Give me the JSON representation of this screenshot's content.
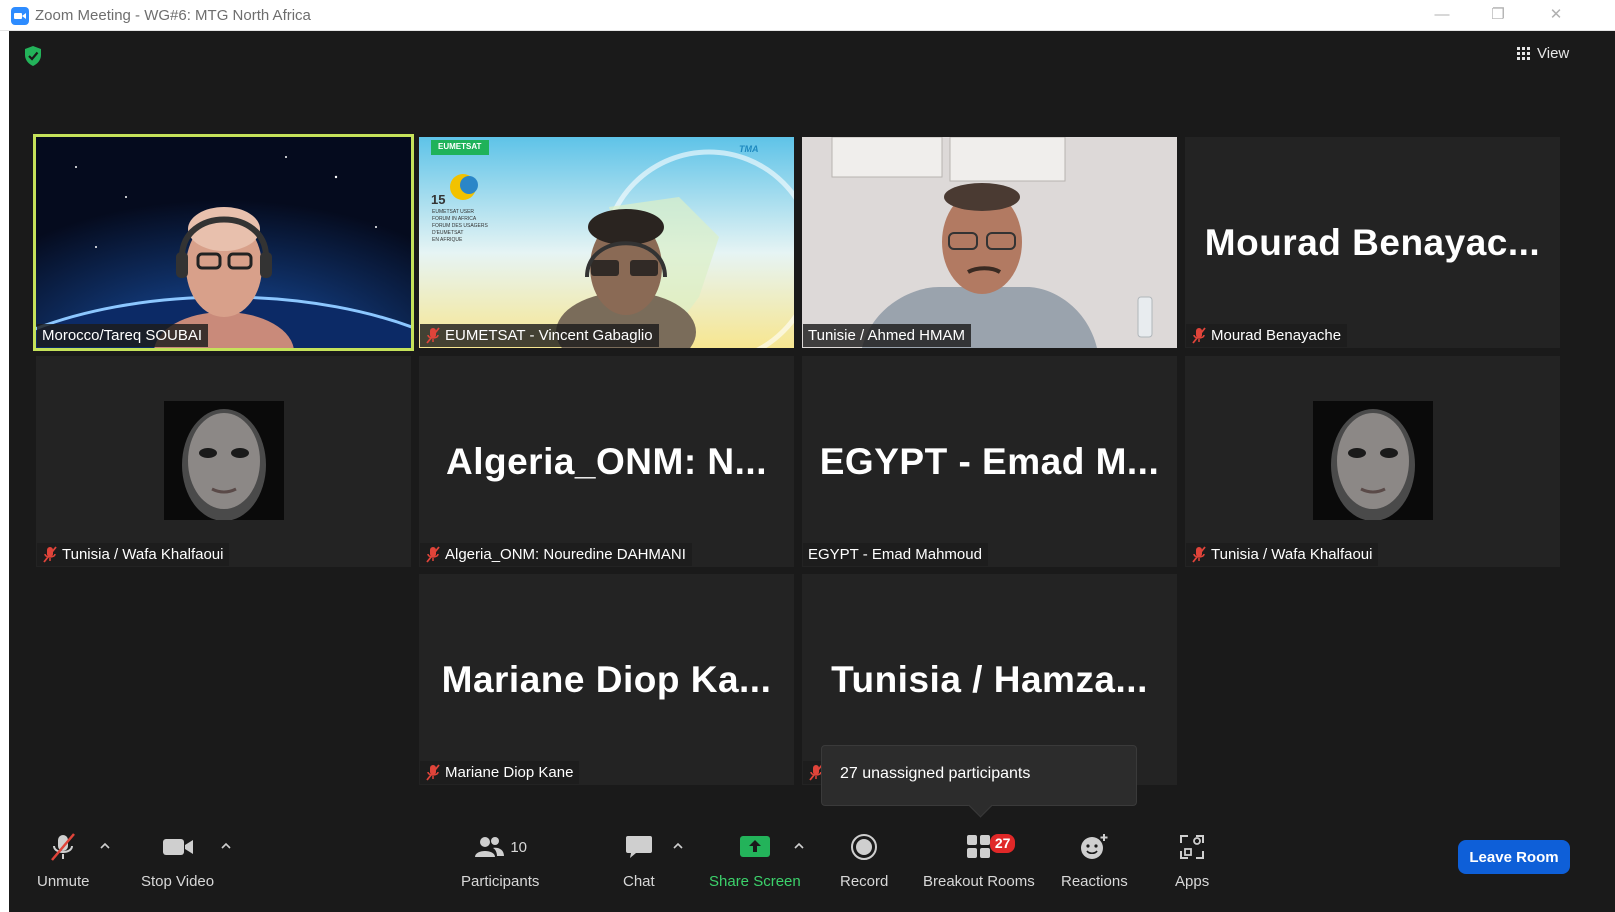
{
  "window": {
    "title": "Zoom Meeting - WG#6: MTG North Africa",
    "minimize_glyph": "—",
    "restore_glyph": "❐",
    "close_glyph": "✕"
  },
  "header": {
    "view_label": "View"
  },
  "tiles": [
    {
      "name": "Morocco/Tareq SOUBAI",
      "big": "",
      "muted": false,
      "active": true
    },
    {
      "name": "EUMETSAT - Vincent Gabaglio",
      "big": "",
      "muted": true,
      "active": false
    },
    {
      "name": "Tunisie / Ahmed HMAM",
      "big": "",
      "muted": false,
      "active": false
    },
    {
      "name": "Mourad Benayache",
      "big": "Mourad  Benayac...",
      "muted": true,
      "active": false
    },
    {
      "name": "Tunisia / Wafa Khalfaoui",
      "big": "",
      "muted": true,
      "active": false
    },
    {
      "name": "Algeria_ONM: Nouredine DAHMANI",
      "big": "Algeria_ONM:  N...",
      "muted": true,
      "active": false
    },
    {
      "name": "EGYPT - Emad Mahmoud",
      "big": "EGYPT  -  Emad  M...",
      "muted": false,
      "active": false
    },
    {
      "name": "Tunisia / Wafa Khalfaoui",
      "big": "",
      "muted": true,
      "active": false
    },
    {
      "name": "Mariane Diop Kane",
      "big": "Mariane  Diop  Ka...",
      "muted": true,
      "active": false
    },
    {
      "name": "",
      "big": "Tunisia  /  Hamza...",
      "muted": true,
      "active": false
    }
  ],
  "slide": {
    "brand": "EUMETSAT",
    "partner": "TMA",
    "number": "15",
    "lines": [
      "EUMETSAT USER",
      "FORUM IN AFRICA",
      "FORUM DES USAGERS",
      "D'EUMETSAT",
      "EN AFRIQUE"
    ]
  },
  "tooltip": {
    "text": "27 unassigned participants"
  },
  "toolbar": {
    "unmute": "Unmute",
    "stop_video": "Stop Video",
    "participants": "Participants",
    "participants_count": "10",
    "chat": "Chat",
    "share_screen": "Share Screen",
    "record": "Record",
    "breakout_rooms": "Breakout Rooms",
    "breakout_badge": "27",
    "reactions": "Reactions",
    "apps": "Apps",
    "leave_room": "Leave Room"
  },
  "colors": {
    "background": "#1a1a1a",
    "tile": "#232323",
    "active_border": "#c5e25a",
    "share_green": "#3cd16b",
    "leave_blue": "#0e5fd8",
    "badge_red": "#e02828",
    "mute_red": "#e0443a"
  }
}
